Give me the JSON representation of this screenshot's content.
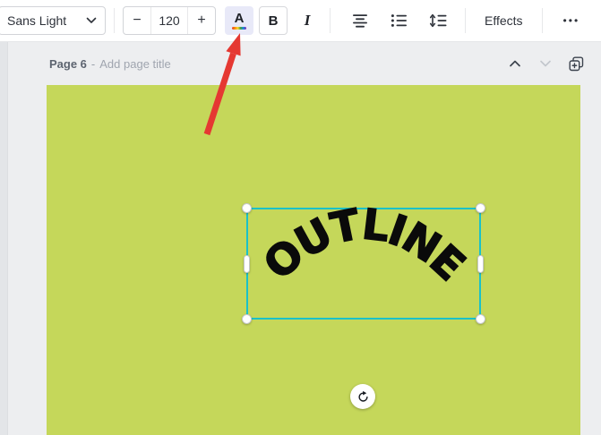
{
  "toolbar": {
    "font_selector": {
      "value": "Sans Light"
    },
    "size": {
      "decrease": "−",
      "value": "120",
      "increase": "+"
    },
    "text_color": {
      "label": "A"
    },
    "bold": {
      "label": "B"
    },
    "italic": {
      "label": "I"
    },
    "effects": {
      "label": "Effects"
    },
    "more": {
      "label": "•••"
    }
  },
  "page_bar": {
    "page_label": "Page 6",
    "separator": "-",
    "title_placeholder": "Add page title"
  },
  "canvas": {
    "selected_text": "OUTLINE"
  },
  "colors": {
    "canvas_green": "#c5d75a",
    "selection_teal": "#1ac1c9",
    "arrow_red": "#e53832"
  }
}
